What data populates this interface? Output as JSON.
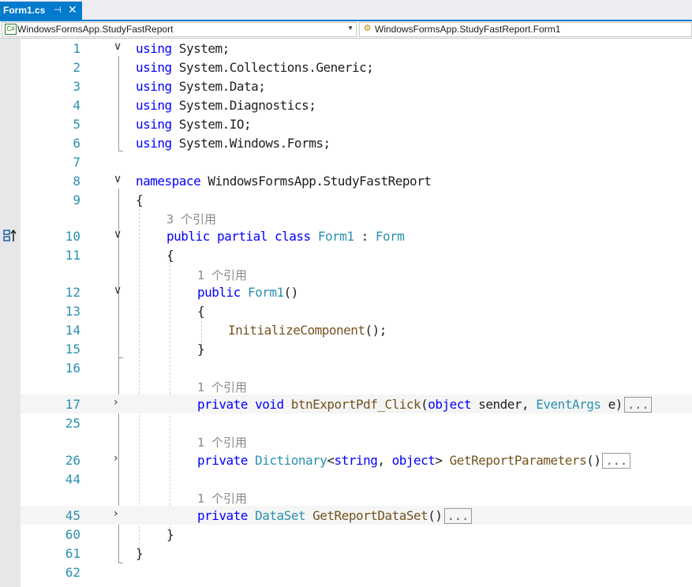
{
  "tab": {
    "title": "Form1.cs",
    "pin": "⊣",
    "close": "✕"
  },
  "nav": {
    "project": "WindowsFormsApp.StudyFastReport",
    "member": "WindowsFormsApp.StudyFastReport.Form1"
  },
  "lines": [
    {
      "n": "1"
    },
    {
      "n": "2"
    },
    {
      "n": "3"
    },
    {
      "n": "4"
    },
    {
      "n": "5"
    },
    {
      "n": "6"
    },
    {
      "n": "7"
    },
    {
      "n": "8"
    },
    {
      "n": "9"
    },
    {
      "n": "10"
    },
    {
      "n": "11"
    },
    {
      "n": "12"
    },
    {
      "n": "13"
    },
    {
      "n": "14"
    },
    {
      "n": "15"
    },
    {
      "n": "16"
    },
    {
      "n": "17"
    },
    {
      "n": "25"
    },
    {
      "n": "26"
    },
    {
      "n": "44"
    },
    {
      "n": "45"
    },
    {
      "n": "60"
    },
    {
      "n": "61"
    },
    {
      "n": "62"
    }
  ],
  "code": {
    "l1": [
      "using",
      " System;"
    ],
    "l2": [
      "using",
      " System.Collections.Generic;"
    ],
    "l3": [
      "using",
      " System.Data;"
    ],
    "l4": [
      "using",
      " System.Diagnostics;"
    ],
    "l5": [
      "using",
      " System.IO;"
    ],
    "l6": [
      "using",
      " System.Windows.Forms;"
    ],
    "l8": [
      "namespace",
      " WindowsFormsApp.StudyFastReport"
    ],
    "l9": "{",
    "lens3": "3 个引用",
    "l10": [
      "public",
      " ",
      "partial",
      " ",
      "class",
      " ",
      "Form1",
      " : ",
      "Form"
    ],
    "l11": "{",
    "lens1a": "1 个引用",
    "l12": [
      "public",
      " ",
      "Form1",
      "()"
    ],
    "l13": "{",
    "l14": [
      "InitializeComponent",
      "();"
    ],
    "l15": "}",
    "lens1b": "1 个引用",
    "l17": [
      "private",
      " ",
      "void",
      " ",
      "btnExportPdf_Click",
      "(",
      "object",
      " sender, ",
      "EventArgs",
      " e)",
      "..."
    ],
    "lens1c": "1 个引用",
    "l26": [
      "private",
      " ",
      "Dictionary",
      "<",
      "string",
      ", ",
      "object",
      "> ",
      "GetReportParameters",
      "()",
      "..."
    ],
    "lens1d": "1 个引用",
    "l45": [
      "private",
      " ",
      "DataSet",
      " ",
      "GetReportDataSet",
      "()",
      "..."
    ],
    "l60": "}",
    "l61": "}"
  },
  "folds": {
    "open": "∨",
    "closed": "›"
  },
  "colors": {
    "accent": "#007acc",
    "keyword": "#0000ff",
    "type": "#2b91af",
    "method": "#74531f"
  }
}
